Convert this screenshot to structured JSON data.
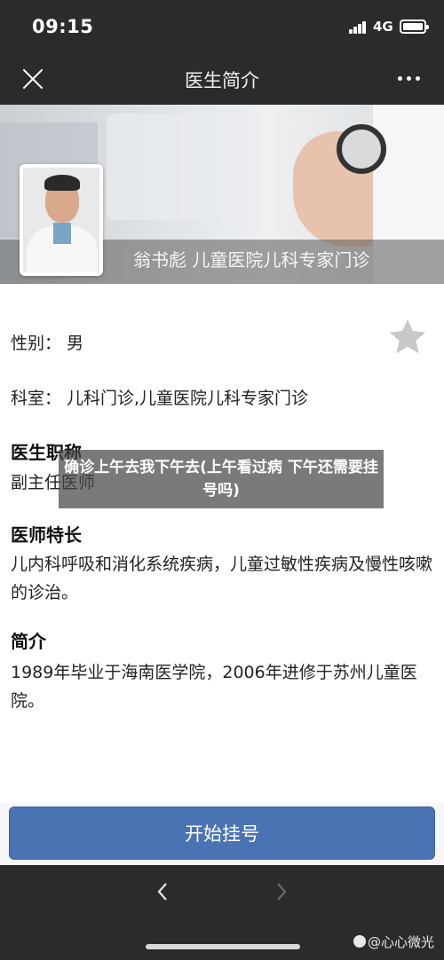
{
  "status_bar": {
    "time": "09:15",
    "network": "4G"
  },
  "nav": {
    "title": "医生简介",
    "close_icon": "close-icon",
    "more_icon": "more-icon"
  },
  "banner": {
    "caption": "翁书彪  儿童医院儿科专家门诊"
  },
  "profile": {
    "gender_label": "性别：",
    "gender_value": "男",
    "department_label": "科室：",
    "department_value": "儿科门诊,儿童医院儿科专家门诊",
    "title_heading": "医生职称",
    "title_value": "副主任医师",
    "specialty_heading": "医师特长",
    "specialty_value": "儿内科呼吸和消化系统疾病，儿童过敏性疾病及慢性咳嗽的诊治。",
    "intro_heading": "简介",
    "intro_value": "1989年毕业于海南医学院，2006年进修于苏州儿童医院。"
  },
  "watermark": {
    "text": "确诊上午去我下午去(上午看过病 下午还需要挂号吗)"
  },
  "actions": {
    "register_button": "开始挂号"
  },
  "footer": {
    "credit": "@心心微光"
  },
  "colors": {
    "primary": "#4a73b4",
    "bar": "#2b2b2b",
    "star": "#c8c8c8"
  }
}
